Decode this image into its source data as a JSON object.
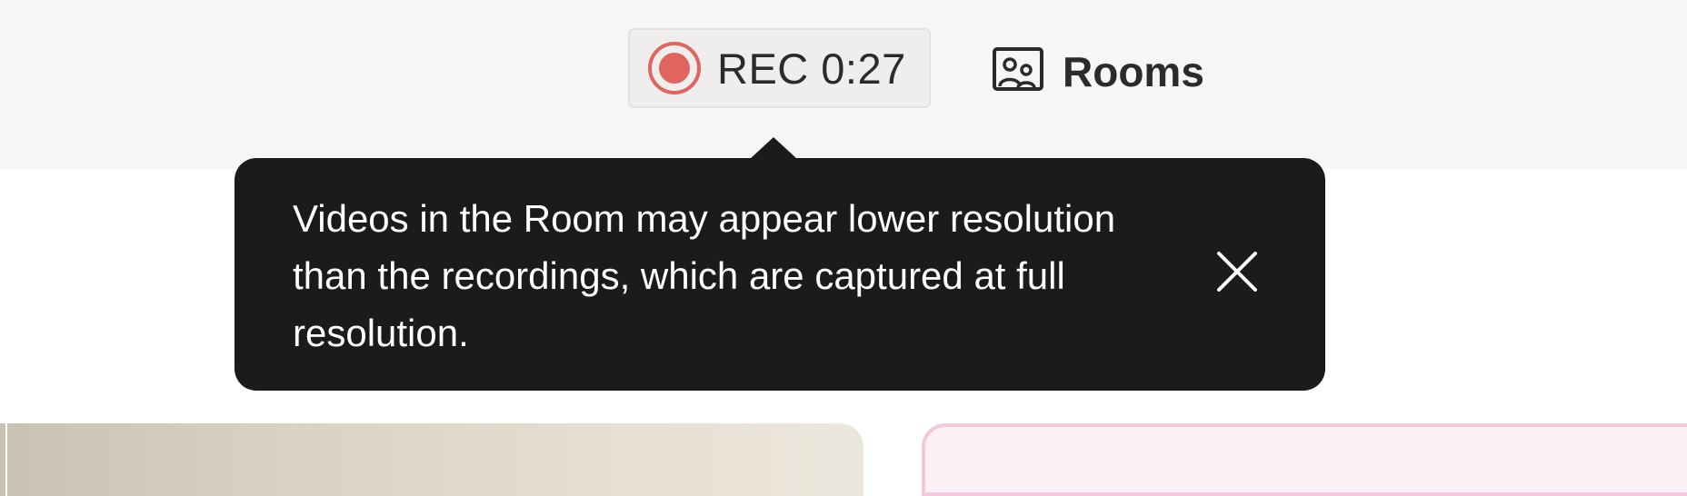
{
  "recording": {
    "label": "REC 0:27",
    "dot_color": "#e0645f"
  },
  "rooms": {
    "label": "Rooms",
    "icon": "rooms-icon"
  },
  "tooltip": {
    "message": "Videos in the Room may appear lower resolution than the recordings, which are captured at full resolution.",
    "close_icon": "close-icon"
  },
  "colors": {
    "topbar_bg": "#f7f6f4",
    "tooltip_bg": "#1b1b1b",
    "participant_tile_border": "#f3c8dc"
  }
}
